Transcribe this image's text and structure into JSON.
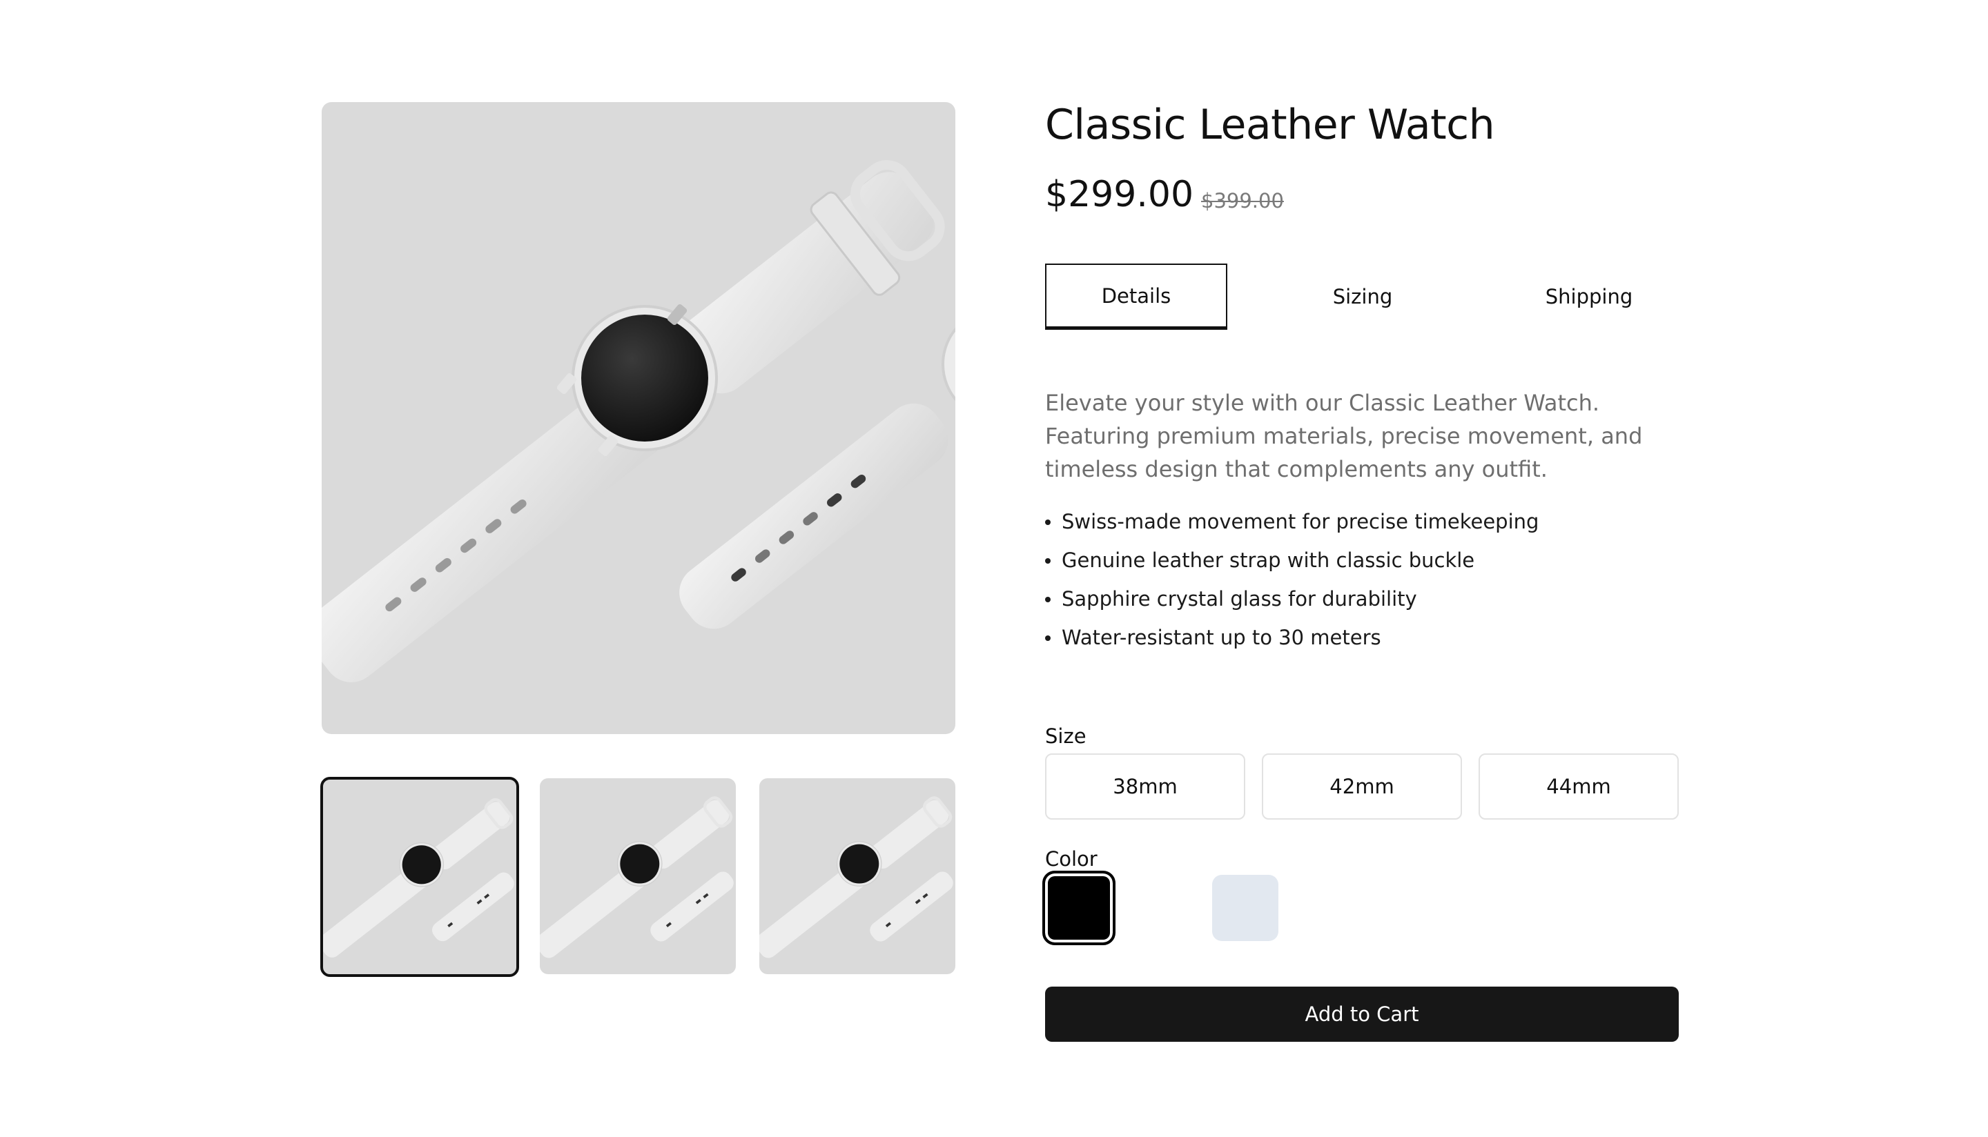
{
  "product": {
    "title": "Classic Leather Watch",
    "price": "$299.00",
    "original_price": "$399.00",
    "description": "Elevate your style with our Classic Leather Watch. Featuring premium materials, precise movement, and timeless design that complements any outfit.",
    "features": [
      "Swiss-made movement for precise timekeeping",
      "Genuine leather strap with classic buckle",
      "Sapphire crystal glass for durability",
      "Water-resistant up to 30 meters"
    ]
  },
  "tabs": [
    {
      "label": "Details",
      "active": true
    },
    {
      "label": "Sizing",
      "active": false
    },
    {
      "label": "Shipping",
      "active": false
    }
  ],
  "size": {
    "label": "Size",
    "options": [
      "38mm",
      "42mm",
      "44mm"
    ]
  },
  "color": {
    "label": "Color",
    "options": [
      {
        "name": "black",
        "hex": "#000000",
        "selected": true
      },
      {
        "name": "white",
        "hex": "#ffffff",
        "selected": false
      },
      {
        "name": "silver",
        "hex": "#e2e8f0",
        "selected": false
      }
    ]
  },
  "cart": {
    "button_label": "Add to Cart"
  },
  "gallery": {
    "selected_thumbnail": 1,
    "thumbnail_count": 3
  },
  "colors": {
    "image_background": "#dadada",
    "button_background": "#171717",
    "muted_text": "#6e6e6e"
  }
}
